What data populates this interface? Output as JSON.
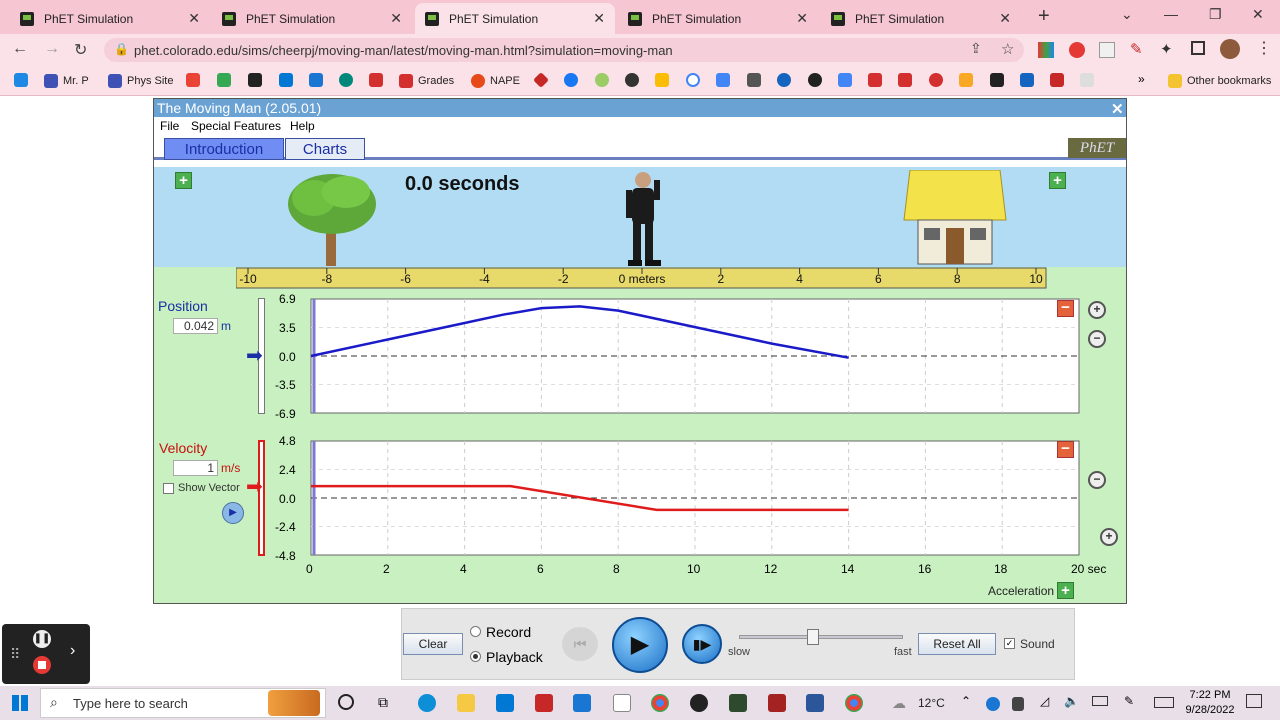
{
  "browser": {
    "tabs": [
      {
        "title": "PhET Simulation",
        "active": false
      },
      {
        "title": "PhET Simulation",
        "active": false
      },
      {
        "title": "PhET Simulation",
        "active": true
      },
      {
        "title": "PhET Simulation",
        "active": false
      },
      {
        "title": "PhET Simulation",
        "active": false
      }
    ],
    "url": "phet.colorado.edu/sims/cheerpj/moving-man/latest/moving-man.html?simulation=moving-man",
    "bookmarks": [
      {
        "label": "Mr. P",
        "color": "#3f51b5"
      },
      {
        "label": "Phys Site",
        "color": "#3f51b5"
      },
      {
        "label": "Grades",
        "color": "#d32f2f"
      },
      {
        "label": "NAPE",
        "color": "#e64a19"
      },
      {
        "label": "Other bookmarks",
        "color": "#f4c430"
      }
    ]
  },
  "sim": {
    "title": "The Moving Man (2.05.01)",
    "menu": [
      "File",
      "Special Features",
      "Help"
    ],
    "tabs": [
      {
        "label": "Introduction",
        "active": true
      },
      {
        "label": "Charts",
        "active": false
      }
    ],
    "logo": "PhET",
    "time_readout": "0.0 seconds",
    "ruler": {
      "ticks": [
        "-10",
        "-8",
        "-6",
        "-4",
        "-2",
        "0 meters",
        "2",
        "4",
        "6",
        "8",
        "10"
      ]
    },
    "position": {
      "label": "Position",
      "value": "0.042",
      "unit": "m",
      "y_ticks": [
        "6.9",
        "3.5",
        "0.0",
        "-3.5",
        "-6.9"
      ],
      "ylim": [
        -6.9,
        6.9
      ],
      "color": "#1a1ac8"
    },
    "velocity": {
      "label": "Velocity",
      "value": "1",
      "unit": "m/s",
      "y_ticks": [
        "4.8",
        "2.4",
        "0.0",
        "-2.4",
        "-4.8"
      ],
      "ylim": [
        -4.8,
        4.8
      ],
      "show_vector_label": "Show Vector",
      "color": "#e01b1b"
    },
    "x_ticks": [
      "0",
      "2",
      "4",
      "6",
      "8",
      "10",
      "12",
      "14",
      "16",
      "18",
      "20 sec"
    ],
    "acceleration_label": "Acceleration",
    "controls": {
      "clear": "Clear",
      "record": "Record",
      "playback": "Playback",
      "slow": "slow",
      "fast": "fast",
      "reset": "Reset All",
      "sound": "Sound",
      "speed": 0.45
    }
  },
  "chart_data": [
    {
      "type": "line",
      "title": "",
      "ylabel": "Position",
      "xlim": [
        0,
        20
      ],
      "ylim": [
        -6.9,
        6.9
      ],
      "series": [
        {
          "x": [
            0,
            2,
            4,
            5,
            6,
            7,
            8,
            10,
            12,
            14
          ],
          "y": [
            0,
            2,
            4,
            5,
            5.8,
            6.0,
            5.5,
            3.5,
            1.5,
            -0.2
          ]
        }
      ]
    },
    {
      "type": "line",
      "title": "",
      "ylabel": "Velocity",
      "xlim": [
        0,
        20
      ],
      "ylim": [
        -4.8,
        4.8
      ],
      "series": [
        {
          "x": [
            0,
            5.2,
            9,
            14
          ],
          "y": [
            1,
            1,
            -1,
            -1
          ]
        }
      ]
    }
  ],
  "system": {
    "search_placeholder": "Type here to search",
    "weather": "12°C",
    "time": "7:22 PM",
    "date": "9/28/2022"
  }
}
